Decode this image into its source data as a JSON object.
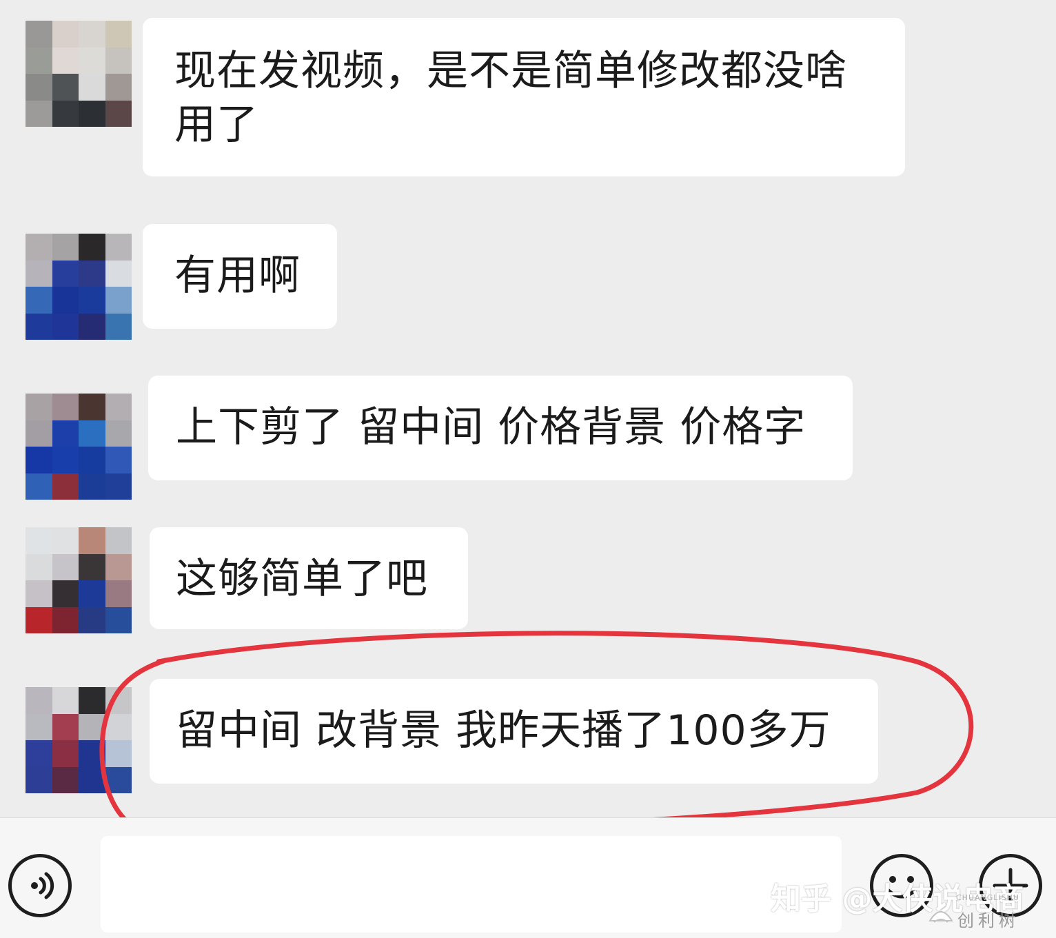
{
  "messages": [
    {
      "text_line1": "现在发视频，是不是简单修改都没啥",
      "text_line2": "用了"
    },
    {
      "text": "有用啊"
    },
    {
      "text": "上下剪了 留中间 价格背景 价格字"
    },
    {
      "text": "这够简单了吧"
    },
    {
      "text": "留中间 改背景 我昨天播了100多万",
      "highlighted": true
    }
  ],
  "avatars": [
    [
      "#9a9896",
      "#d9cfcb",
      "#d8d4cf",
      "#cfc7b6",
      "#9a9c98",
      "#e0d8d5",
      "#dddbd8",
      "#c6c3be",
      "#8a8b88",
      "#4f5356",
      "#dadada",
      "#a09894",
      "#9c9b99",
      "#363a3e",
      "#2c3034",
      "#5c4748"
    ],
    [
      "#b3aeaf",
      "#a6a3a4",
      "#2a2828",
      "#b8b6b8",
      "#b7b3bb",
      "#283e9c",
      "#2d3a8a",
      "#d9dde2",
      "#3569b8",
      "#183498",
      "#1a3b9c",
      "#7aa0cc",
      "#1e3a9a",
      "#1f3597",
      "#252c73",
      "#3a74b0"
    ],
    [
      "#a9a2a4",
      "#9e8c92",
      "#4a3530",
      "#b3aeb1",
      "#a39ea3",
      "#1d3faa",
      "#2a6fc0",
      "#a8a8ac",
      "#1637a6",
      "#183eab",
      "#173c9f",
      "#2f58b7",
      "#2f62b6",
      "#8c2f3a",
      "#1b3d98",
      "#1f3f99"
    ],
    [
      "#dfe3e6",
      "#dfe1e3",
      "#b98778",
      "#c3c4c8",
      "#d9dbdc",
      "#c6c4c8",
      "#3a3537",
      "#b99894",
      "#c6c1c7",
      "#352f33",
      "#1e3a99",
      "#9a7a82",
      "#b8262b",
      "#7d2430",
      "#263b84",
      "#274e9a"
    ],
    [
      "#b9b7bd",
      "#d7d6d9",
      "#2b2a2c",
      "#c6c6c9",
      "#b9bac0",
      "#a23e50",
      "#b4b3b8",
      "#d2d3d7",
      "#2e3f9b",
      "#8a2f44",
      "#1f3590",
      "#b6c3d6",
      "#2c3e96",
      "#5a2a44",
      "#1f3590",
      "#2a4b9b"
    ]
  ],
  "input": {
    "placeholder": ""
  },
  "icons": {
    "voice": "voice-icon",
    "emoji": "emoji-icon",
    "plus": "plus-icon"
  },
  "watermark": "知乎 @大侠说电商",
  "logo": {
    "top": "CHUANGLISHU",
    "bottom": "创利树"
  },
  "colors": {
    "background": "#ededed",
    "bubble": "#ffffff",
    "highlight_circle": "#e4343d"
  }
}
